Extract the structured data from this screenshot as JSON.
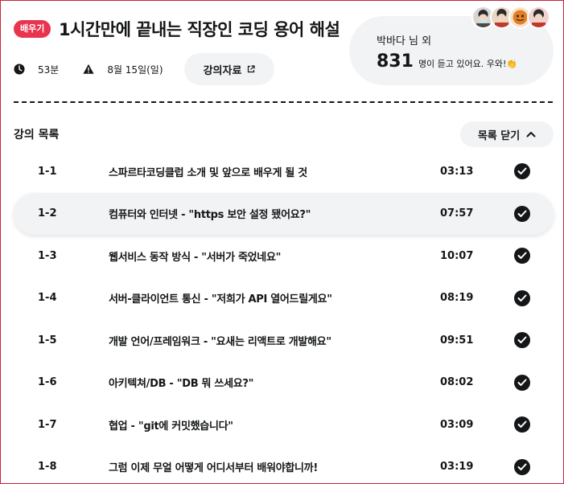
{
  "header": {
    "badge": "배우기",
    "title": "1시간만에 끝내는 직장인 코딩 용어 해설",
    "duration": "53분",
    "date": "8월 15일(일)",
    "material_button": "강의자료"
  },
  "listeners": {
    "name": "박바다 님 외",
    "count": "831",
    "message": "명이 듣고 있어요. 우와!👏"
  },
  "list": {
    "title": "강의 목록",
    "close_button": "목록 닫기",
    "items": [
      {
        "num": "1-1",
        "name": "스파르타코딩클럽 소개 및 앞으로 배우게 될 것",
        "duration": "03:13"
      },
      {
        "num": "1-2",
        "name": "컴퓨터와 인터넷 - \"https 보안 설정 됐어요?\"",
        "duration": "07:57"
      },
      {
        "num": "1-3",
        "name": "웹서비스 동작 방식 - \"서버가 죽었네요\"",
        "duration": "10:07"
      },
      {
        "num": "1-4",
        "name": "서버-클라이언트 통신 - \"저희가 API 열어드릴게요\"",
        "duration": "08:19"
      },
      {
        "num": "1-5",
        "name": "개발 언어/프레임워크 - \"요새는 리액트로 개발해요\"",
        "duration": "09:51"
      },
      {
        "num": "1-6",
        "name": "아키텍쳐/DB - \"DB 뭐 쓰세요?\"",
        "duration": "08:02"
      },
      {
        "num": "1-7",
        "name": "협업 - \"git에 커밋했습니다\"",
        "duration": "03:09"
      },
      {
        "num": "1-8",
        "name": "그럼 이제 무얼 어떻게 어디서부터 배워야합니까!",
        "duration": "03:19"
      }
    ]
  },
  "colors": {
    "accent": "#e8344e",
    "ink": "#141617",
    "surface": "#f2f3f5"
  },
  "icons": [
    "clock-icon",
    "warning-icon",
    "external-link-icon",
    "chevron-up-icon",
    "check-circle-icon"
  ]
}
